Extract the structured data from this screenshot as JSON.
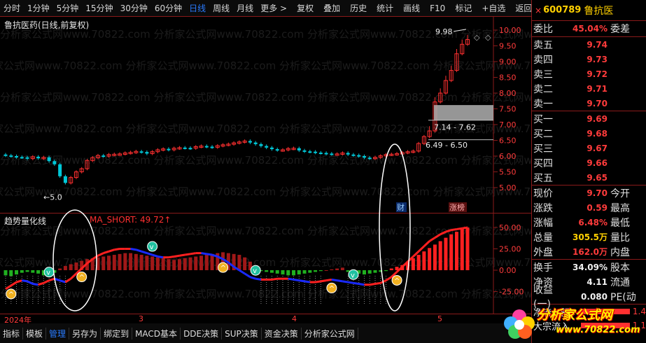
{
  "toolbar": {
    "periods": [
      "分时",
      "1分钟",
      "5分钟",
      "15分钟",
      "30分钟",
      "60分钟",
      "日线",
      "周线",
      "月线",
      "更多 >"
    ],
    "active_period": "日线",
    "tools": [
      "复权",
      "叠加",
      "历史",
      "统计",
      "画线",
      "F10",
      "标记",
      "+自选",
      "返回"
    ]
  },
  "chart": {
    "stock_title": "鲁抗医药(日线,前复权)",
    "price_ticks": [
      "10.00",
      "9.50",
      "9.00",
      "8.50",
      "8.00",
      "7.50",
      "7.00",
      "6.50",
      "6.00",
      "5.50",
      "5.00"
    ],
    "high_label": "9.98",
    "low_label": "5.0",
    "range_box_1": "7.14 - 7.62",
    "range_box_2": "6.49 - 6.50",
    "badge_cai": "财",
    "badge_zhangting": "涨榜",
    "watermark": "分析家公式网www.70822.com"
  },
  "indicator": {
    "title": "趋势量化线",
    "value_label": "MA_SHORT: 49.72↑",
    "ticks": [
      "50.00",
      "25.00",
      "0.00",
      "-25.00"
    ]
  },
  "time_axis": {
    "labels": [
      "2024年",
      "3",
      "4",
      "5"
    ]
  },
  "bottombar": {
    "items": [
      "指标",
      "模板",
      "管理",
      "另存为",
      "绑定到",
      "MACD基本",
      "DDE决策",
      "SUP决策",
      "资金决策",
      "分析家公式网"
    ],
    "active": "管理"
  },
  "quote": {
    "close_icon": "×",
    "code": "600789",
    "name": "鲁抗医",
    "weibi_label": "委比",
    "weibi_value": "45.04%",
    "weicha_label": "委差",
    "asks": [
      {
        "label": "卖五",
        "price": "9.74"
      },
      {
        "label": "卖四",
        "price": "9.73"
      },
      {
        "label": "卖三",
        "price": "9.72"
      },
      {
        "label": "卖二",
        "price": "9.71"
      },
      {
        "label": "卖一",
        "price": "9.70"
      }
    ],
    "bids": [
      {
        "label": "买一",
        "price": "9.69"
      },
      {
        "label": "买二",
        "price": "9.68"
      },
      {
        "label": "买三",
        "price": "9.67"
      },
      {
        "label": "买四",
        "price": "9.66"
      },
      {
        "label": "买五",
        "price": "9.65"
      }
    ],
    "stats": [
      {
        "label": "现价",
        "value": "9.70",
        "label2": "今开",
        "color": "red"
      },
      {
        "label": "涨跌",
        "value": "0.59",
        "label2": "最高",
        "color": "red"
      },
      {
        "label": "涨幅",
        "value": "6.48%",
        "label2": "最低",
        "color": "red"
      },
      {
        "label": "总量",
        "value": "305.5万",
        "label2": "量比",
        "color": "yellow"
      },
      {
        "label": "外盘",
        "value": "162.0万",
        "label2": "内盘",
        "color": "red"
      }
    ],
    "stats2": [
      {
        "label": "换手",
        "value": "34.09%",
        "label2": "股本",
        "color": "white"
      },
      {
        "label": "净资",
        "value": "4.11",
        "label2": "流通",
        "color": "white"
      },
      {
        "label": "收益(一)",
        "value": "0.080",
        "label2": "PE(动",
        "color": "white"
      }
    ],
    "flows": [
      {
        "label": "净流入额",
        "value": "1.4"
      },
      {
        "label": "大宗流入",
        "value": "1.1"
      }
    ]
  },
  "logo": {
    "main": "分析家公式网",
    "sub": "www.70822.com"
  },
  "colors": {
    "up": "#ff3030",
    "down": "#00c8d8",
    "ma_red": "#ff2020",
    "ma_blue": "#1a2aff",
    "hist_green": "#20b020",
    "ellipse": "#ffffff"
  }
}
